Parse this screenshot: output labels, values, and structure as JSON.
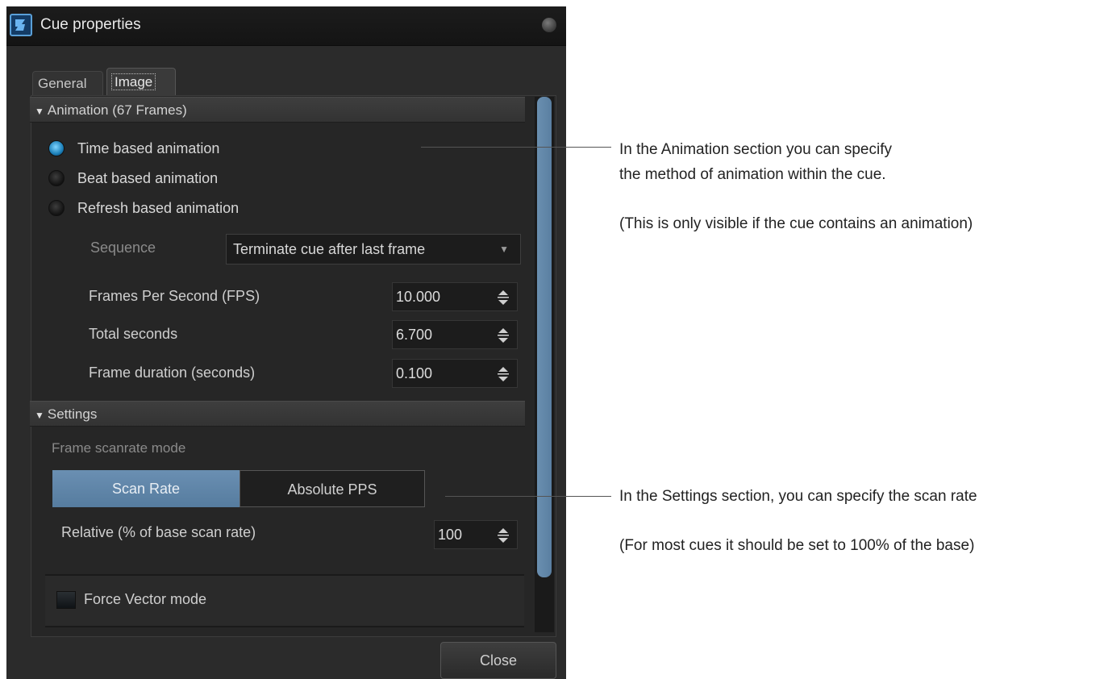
{
  "window": {
    "title": "Cue properties"
  },
  "tabs": [
    {
      "label": "General",
      "active": false
    },
    {
      "label": "Image",
      "active": true
    }
  ],
  "animation": {
    "header": "Animation (67 Frames)",
    "modes": [
      {
        "label": "Time based animation",
        "selected": true
      },
      {
        "label": "Beat based animation",
        "selected": false
      },
      {
        "label": "Refresh based animation",
        "selected": false
      }
    ],
    "sequence_label": "Sequence",
    "sequence_value": "Terminate cue after last frame",
    "fps_label": "Frames Per Second (FPS)",
    "fps_value": "10.000",
    "total_label": "Total seconds",
    "total_value": "6.700",
    "duration_label": "Frame duration (seconds)",
    "duration_value": "0.100"
  },
  "settings": {
    "header": "Settings",
    "scanrate_mode_label": "Frame scanrate mode",
    "scan_rate_button": "Scan Rate",
    "absolute_pps_button": "Absolute PPS",
    "relative_label": "Relative (% of base scan rate)",
    "relative_value": "100",
    "force_vector_label": "Force Vector mode",
    "force_vector_checked": false
  },
  "footer": {
    "close_label": "Close"
  },
  "annotations": {
    "animation_line1": "In the Animation section you can specify",
    "animation_line2": "the method of animation within the cue.",
    "animation_line3": "(This is only visible if the cue contains an animation)",
    "settings_line1": "In the Settings section, you can specify the scan rate",
    "settings_line2": "(For most cues it should be set to 100% of the base)"
  },
  "colors": {
    "window_bg": "#2b2b2b",
    "accent_blue": "#5f86aa",
    "radio_selected": "#2a9be0",
    "text_light": "#d8d8d8"
  }
}
